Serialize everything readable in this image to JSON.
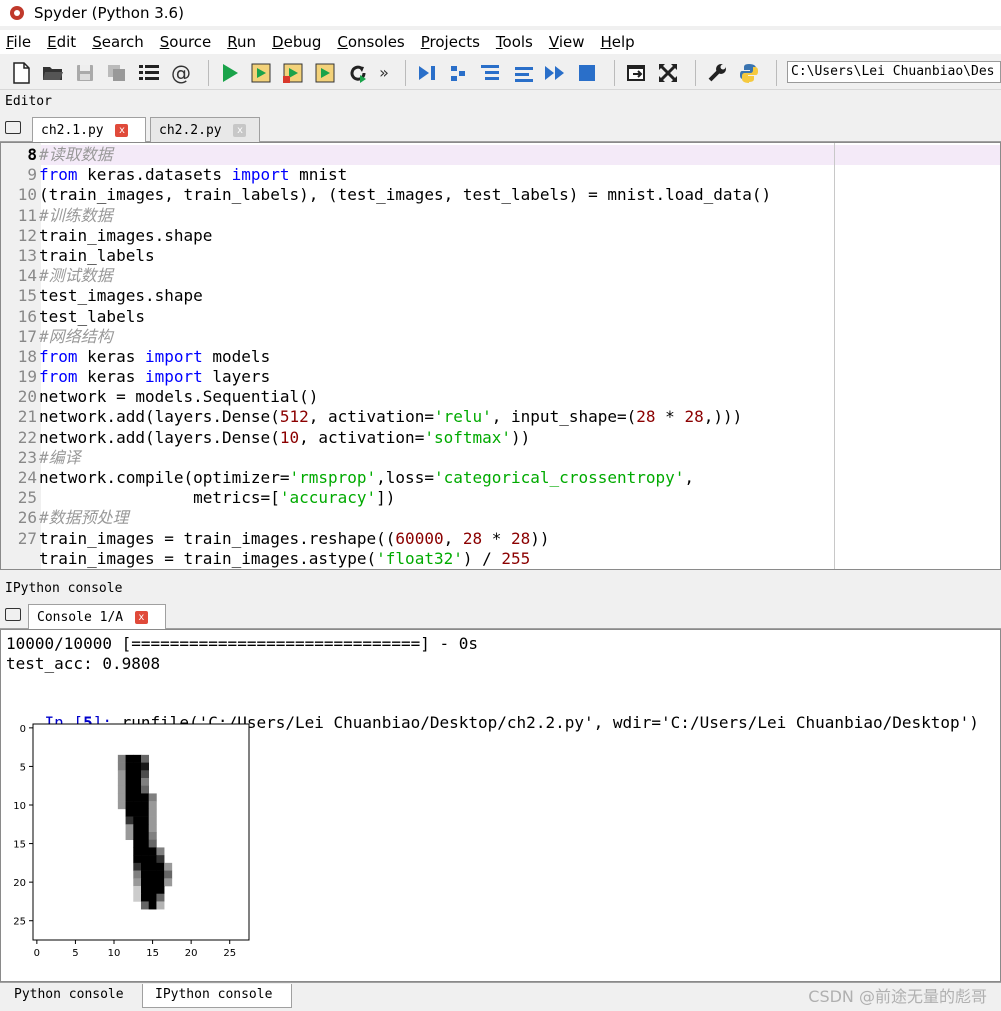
{
  "window": {
    "title": "Spyder (Python 3.6)"
  },
  "menu": [
    "File",
    "Edit",
    "Search",
    "Source",
    "Run",
    "Debug",
    "Consoles",
    "Projects",
    "Tools",
    "View",
    "Help"
  ],
  "toolbar": {
    "overflow": "»",
    "path": "C:\\Users\\Lei Chuanbiao\\Des"
  },
  "editor": {
    "pane_title": "Editor",
    "tabs": [
      {
        "label": "ch2.1.py",
        "close": "x"
      },
      {
        "label": "ch2.2.py",
        "close": "x"
      }
    ],
    "current_line": 8,
    "lines": [
      {
        "n": "8",
        "parts": [
          [
            "cm",
            "#读取数据"
          ]
        ]
      },
      {
        "n": "9",
        "parts": [
          [
            "kw",
            "from"
          ],
          [
            "txt",
            " keras.datasets "
          ],
          [
            "kw",
            "import"
          ],
          [
            "txt",
            " mnist"
          ]
        ]
      },
      {
        "n": "10",
        "parts": [
          [
            "txt",
            "(train_images, train_labels), (test_images, test_labels) = mnist.load_data()"
          ]
        ]
      },
      {
        "n": "11",
        "parts": [
          [
            "cm",
            "#训练数据"
          ]
        ]
      },
      {
        "n": "12",
        "parts": [
          [
            "txt",
            "train_images.shape"
          ]
        ]
      },
      {
        "n": "13",
        "parts": [
          [
            "txt",
            "train_labels"
          ]
        ]
      },
      {
        "n": "14",
        "parts": [
          [
            "cm",
            "#测试数据"
          ]
        ]
      },
      {
        "n": "15",
        "parts": [
          [
            "txt",
            "test_images.shape"
          ]
        ]
      },
      {
        "n": "16",
        "parts": [
          [
            "txt",
            "test_labels"
          ]
        ]
      },
      {
        "n": "17",
        "parts": [
          [
            "cm",
            "#网络结构"
          ]
        ]
      },
      {
        "n": "18",
        "parts": [
          [
            "kw",
            "from"
          ],
          [
            "txt",
            " keras "
          ],
          [
            "kw",
            "import"
          ],
          [
            "txt",
            " models"
          ]
        ]
      },
      {
        "n": "19",
        "parts": [
          [
            "kw",
            "from"
          ],
          [
            "txt",
            " keras "
          ],
          [
            "kw",
            "import"
          ],
          [
            "txt",
            " layers"
          ]
        ]
      },
      {
        "n": "20",
        "parts": [
          [
            "txt",
            "network = models.Sequential()"
          ]
        ]
      },
      {
        "n": "21",
        "parts": [
          [
            "txt",
            "network.add(layers.Dense("
          ],
          [
            "nm",
            "512"
          ],
          [
            "txt",
            ", activation="
          ],
          [
            "str",
            "'relu'"
          ],
          [
            "txt",
            ", input_shape=("
          ],
          [
            "nm",
            "28"
          ],
          [
            "txt",
            " * "
          ],
          [
            "nm",
            "28"
          ],
          [
            "txt",
            ",)))"
          ]
        ]
      },
      {
        "n": "22",
        "parts": [
          [
            "txt",
            "network.add(layers.Dense("
          ],
          [
            "nm",
            "10"
          ],
          [
            "txt",
            ", activation="
          ],
          [
            "str",
            "'softmax'"
          ],
          [
            "txt",
            "))"
          ]
        ]
      },
      {
        "n": "23",
        "parts": [
          [
            "cm",
            "#编译"
          ]
        ]
      },
      {
        "n": "24",
        "parts": [
          [
            "txt",
            "network.compile(optimizer="
          ],
          [
            "str",
            "'rmsprop'"
          ],
          [
            "txt",
            ",loss="
          ],
          [
            "str",
            "'categorical_crossentropy'"
          ],
          [
            "txt",
            ","
          ]
        ]
      },
      {
        "n": "25",
        "parts": [
          [
            "txt",
            "                metrics=["
          ],
          [
            "str",
            "'accuracy'"
          ],
          [
            "txt",
            "])"
          ]
        ]
      },
      {
        "n": "26",
        "parts": [
          [
            "cm",
            "#数据预处理"
          ]
        ]
      },
      {
        "n": "27",
        "parts": [
          [
            "txt",
            "train_images = train_images.reshape(("
          ],
          [
            "nm",
            "60000"
          ],
          [
            "txt",
            ", "
          ],
          [
            "nm",
            "28"
          ],
          [
            "txt",
            " * "
          ],
          [
            "nm",
            "28"
          ],
          [
            "txt",
            "))"
          ]
        ]
      },
      {
        "n": "",
        "parts": [
          [
            "txt",
            "train_images = train_images.astype("
          ],
          [
            "str",
            "'float32'"
          ],
          [
            "txt",
            ") / "
          ],
          [
            "nm",
            "255"
          ]
        ]
      }
    ]
  },
  "console": {
    "pane_title": "IPython console",
    "tab": {
      "label": "Console 1/A",
      "close": "x"
    },
    "progress_line": "10000/10000 [==============================] - 0s",
    "acc_line": "test_acc: 0.9808",
    "prompt_in": "In [",
    "prompt_num": "5",
    "prompt_end": "]:",
    "command": " runfile('C:/Users/Lei Chuanbiao/Desktop/ch2.2.py', wdir='C:/Users/Lei Chuanbiao/Desktop')"
  },
  "chart_data": {
    "type": "heatmap",
    "xlabel": "",
    "ylabel": "",
    "x_ticks": [
      "0",
      "5",
      "10",
      "15",
      "20",
      "25"
    ],
    "y_ticks": [
      "0",
      "5",
      "10",
      "15",
      "20",
      "25"
    ],
    "xlim": [
      -0.5,
      27.5
    ],
    "ylim": [
      27.5,
      -0.5
    ],
    "colormap": "binary",
    "pixels": [
      [
        4,
        11,
        0.5
      ],
      [
        4,
        12,
        1
      ],
      [
        4,
        13,
        1
      ],
      [
        4,
        14,
        0.6
      ],
      [
        5,
        11,
        0.5
      ],
      [
        5,
        12,
        1
      ],
      [
        5,
        13,
        1
      ],
      [
        5,
        14,
        0.9
      ],
      [
        6,
        11,
        0.4
      ],
      [
        6,
        12,
        1
      ],
      [
        6,
        13,
        1
      ],
      [
        6,
        14,
        0.7
      ],
      [
        7,
        11,
        0.4
      ],
      [
        7,
        12,
        1
      ],
      [
        7,
        13,
        1
      ],
      [
        7,
        14,
        0.5
      ],
      [
        8,
        11,
        0.4
      ],
      [
        8,
        12,
        1
      ],
      [
        8,
        13,
        1
      ],
      [
        8,
        14,
        0.6
      ],
      [
        9,
        11,
        0.4
      ],
      [
        9,
        12,
        1
      ],
      [
        9,
        13,
        1
      ],
      [
        9,
        14,
        1
      ],
      [
        9,
        15,
        0.5
      ],
      [
        10,
        11,
        0.4
      ],
      [
        10,
        12,
        1
      ],
      [
        10,
        13,
        1
      ],
      [
        10,
        14,
        1
      ],
      [
        10,
        15,
        0.4
      ],
      [
        11,
        12,
        1
      ],
      [
        11,
        13,
        1
      ],
      [
        11,
        14,
        1
      ],
      [
        11,
        15,
        0.4
      ],
      [
        12,
        12,
        0.8
      ],
      [
        12,
        13,
        1
      ],
      [
        12,
        14,
        1
      ],
      [
        12,
        15,
        0.4
      ],
      [
        13,
        12,
        0.4
      ],
      [
        13,
        13,
        1
      ],
      [
        13,
        14,
        1
      ],
      [
        13,
        15,
        0.4
      ],
      [
        14,
        12,
        0.4
      ],
      [
        14,
        13,
        1
      ],
      [
        14,
        14,
        1
      ],
      [
        14,
        15,
        0.5
      ],
      [
        15,
        13,
        1
      ],
      [
        15,
        14,
        1
      ],
      [
        15,
        15,
        0.6
      ],
      [
        16,
        13,
        1
      ],
      [
        16,
        14,
        1
      ],
      [
        16,
        15,
        1
      ],
      [
        16,
        16,
        0.5
      ],
      [
        17,
        13,
        1
      ],
      [
        17,
        14,
        1
      ],
      [
        17,
        15,
        1
      ],
      [
        17,
        16,
        0.8
      ],
      [
        18,
        13,
        0.8
      ],
      [
        18,
        14,
        1
      ],
      [
        18,
        15,
        1
      ],
      [
        18,
        16,
        1
      ],
      [
        18,
        17,
        0.4
      ],
      [
        19,
        13,
        0.5
      ],
      [
        19,
        14,
        1
      ],
      [
        19,
        15,
        1
      ],
      [
        19,
        16,
        1
      ],
      [
        19,
        17,
        0.6
      ],
      [
        20,
        13,
        0.4
      ],
      [
        20,
        14,
        1
      ],
      [
        20,
        15,
        1
      ],
      [
        20,
        16,
        1
      ],
      [
        20,
        17,
        0.4
      ],
      [
        21,
        13,
        0.2
      ],
      [
        21,
        14,
        1
      ],
      [
        21,
        15,
        1
      ],
      [
        21,
        16,
        1
      ],
      [
        22,
        13,
        0.2
      ],
      [
        22,
        14,
        1
      ],
      [
        22,
        15,
        1
      ],
      [
        22,
        16,
        0.6
      ],
      [
        23,
        14,
        0.6
      ],
      [
        23,
        15,
        1
      ],
      [
        23,
        16,
        0.3
      ]
    ]
  },
  "bottom_tabs": [
    "Python console",
    "IPython console"
  ],
  "watermark": "CSDN @前途无量的彪哥"
}
